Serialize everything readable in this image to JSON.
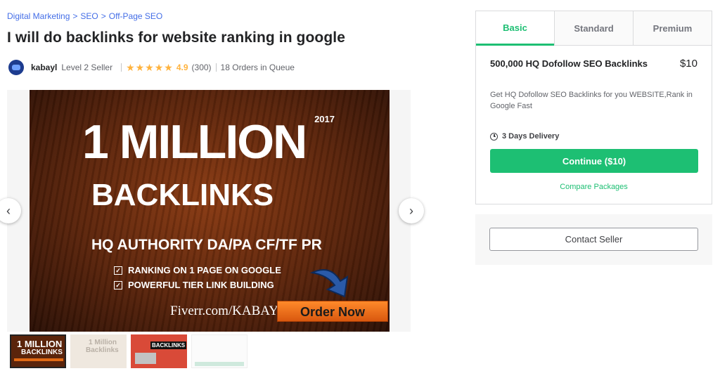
{
  "breadcrumb": [
    "Digital Marketing",
    "SEO",
    "Off-Page SEO"
  ],
  "breadcrumb_separator": ">",
  "gig": {
    "title": "I will do backlinks for website ranking in google",
    "seller": {
      "name": "kabayl",
      "level": "Level 2 Seller",
      "stars": "★★★★★",
      "rating": "4.9",
      "review_count": "(300)",
      "orders_in_queue": "18 Orders in Queue"
    }
  },
  "hero": {
    "year": "2017",
    "big_text": "1 MILLION",
    "sub_text": "BACKLINKS",
    "authority": "HQ AUTHORITY DA/PA CF/TF PR",
    "bullets": [
      "RANKING ON 1 PAGE ON GOOGLE",
      "POWERFUL TIER LINK BUILDING"
    ],
    "site": "Fiverr.com/KABAYL",
    "order_button": "Order Now"
  },
  "gallery": {
    "prev_icon": "chevron-left-icon",
    "next_icon": "chevron-right-icon",
    "thumbnails": [
      {
        "line1": "1 MILLION",
        "line2": "BACKLINKS"
      },
      {
        "line1": "1 Million",
        "line2": "Backlinks"
      },
      {
        "line1": "BACKLINKS",
        "line2": ""
      },
      {
        "line1": "",
        "line2": ""
      }
    ]
  },
  "packages": {
    "tabs": [
      "Basic",
      "Standard",
      "Premium"
    ],
    "active_tab": "Basic",
    "name": "500,000 HQ Dofollow SEO Backlinks",
    "price": "$10",
    "description": "Get HQ Dofollow SEO Backlinks for you WEBSITE,Rank in Google Fast",
    "delivery": "3 Days Delivery",
    "continue_label": "Continue ($10)",
    "compare_label": "Compare Packages"
  },
  "contact": {
    "button_label": "Contact Seller"
  },
  "colors": {
    "accent": "#1dbf73",
    "link": "#446ee7",
    "star": "#ffb33e"
  }
}
